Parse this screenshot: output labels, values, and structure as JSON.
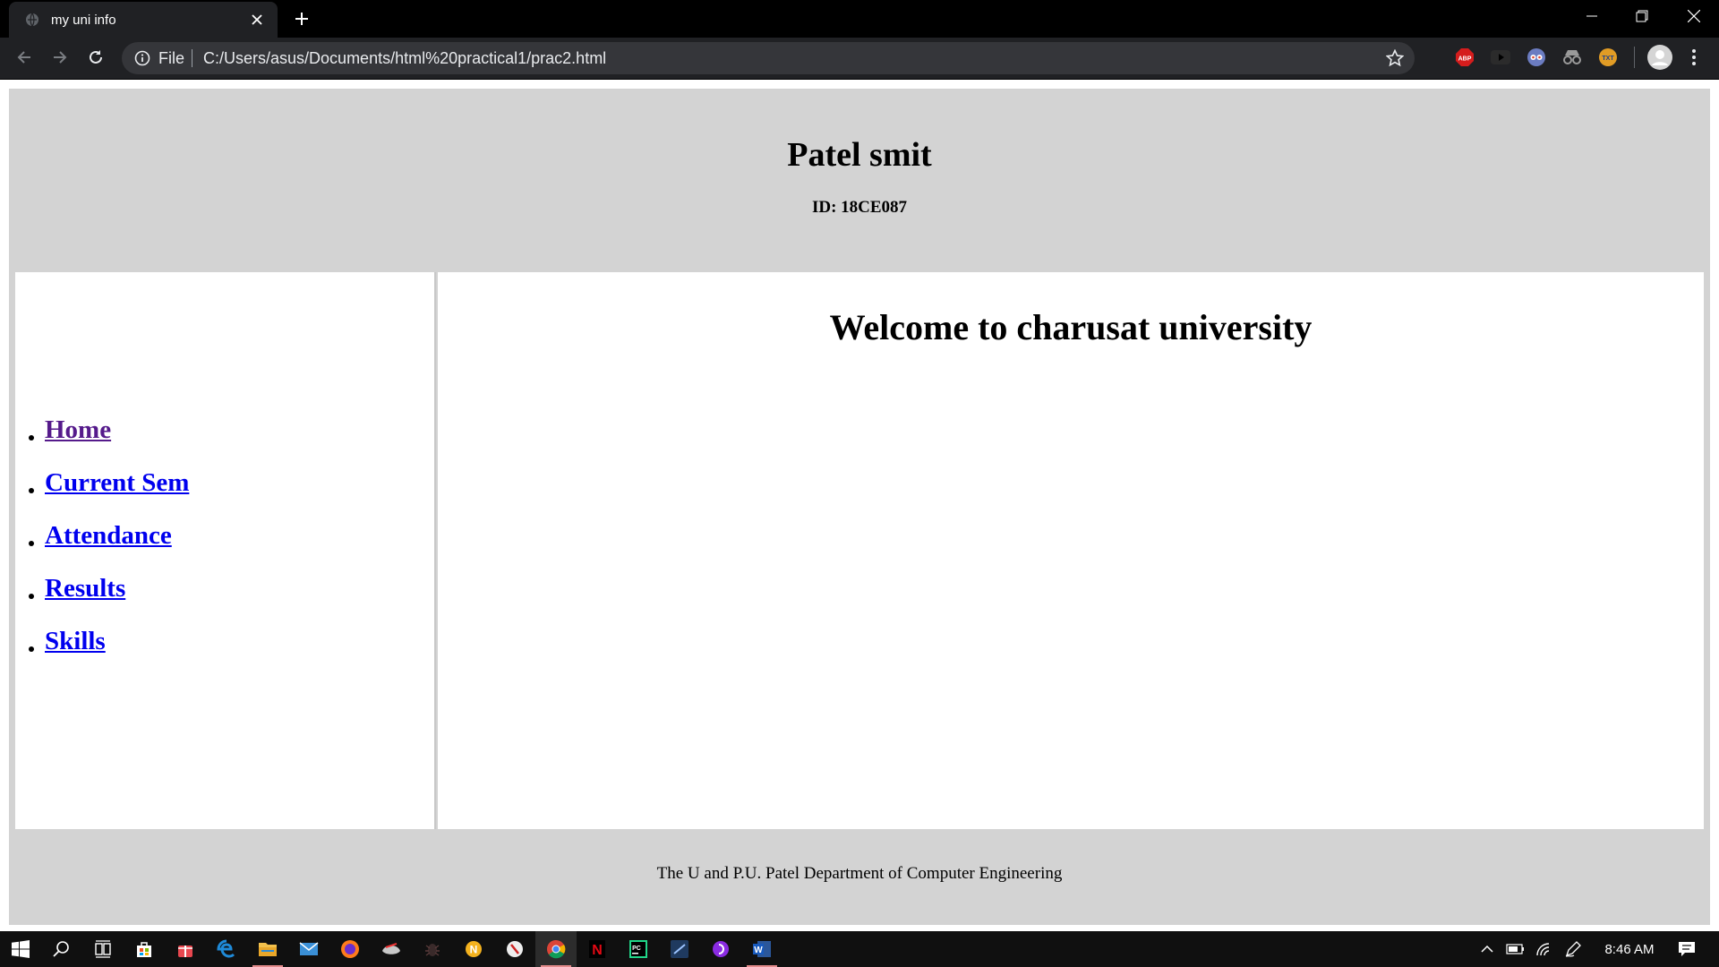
{
  "browser": {
    "tab_title": "my uni info",
    "scheme_label": "File",
    "url": "C:/Users/asus/Documents/html%20practical1/prac2.html",
    "extensions": [
      {
        "name": "adblock-plus-icon",
        "color": "#d51d1d",
        "text": "ABP"
      },
      {
        "name": "youtube-extension-icon",
        "color": "#2b2b2b",
        "text": ""
      },
      {
        "name": "owl-extension-icon",
        "color": "#6b7cc1",
        "text": ""
      },
      {
        "name": "incognito-extension-icon",
        "color": "#9a9a9a",
        "text": ""
      },
      {
        "name": "text-extension-icon",
        "color": "#e19c25",
        "text": "TXT"
      }
    ]
  },
  "page": {
    "header": {
      "name": "Patel smit",
      "id": "ID: 18CE087"
    },
    "nav": [
      {
        "label": "Home",
        "visited": true
      },
      {
        "label": "Current Sem",
        "visited": false
      },
      {
        "label": "Attendance",
        "visited": false
      },
      {
        "label": "Results",
        "visited": false
      },
      {
        "label": "Skills",
        "visited": false
      }
    ],
    "main_heading": "Welcome to charusat university",
    "footer": "The U and P.U. Patel Department of Computer Engineering"
  },
  "taskbar": {
    "apps": [
      {
        "name": "windows-start-icon"
      },
      {
        "name": "search-icon"
      },
      {
        "name": "task-view-icon"
      },
      {
        "name": "store-icon"
      },
      {
        "name": "gift-app-icon"
      },
      {
        "name": "edge-icon"
      },
      {
        "name": "file-explorer-icon"
      },
      {
        "name": "mail-icon"
      },
      {
        "name": "firefox-icon"
      },
      {
        "name": "game-app-icon"
      },
      {
        "name": "bug-app-icon"
      },
      {
        "name": "norton-app-icon"
      },
      {
        "name": "compass-app-icon"
      },
      {
        "name": "chrome-icon"
      },
      {
        "name": "netflix-icon"
      },
      {
        "name": "pycharm-icon"
      },
      {
        "name": "notes-app-icon"
      },
      {
        "name": "podcast-app-icon"
      },
      {
        "name": "word-icon"
      }
    ],
    "time": "8:46 AM"
  }
}
